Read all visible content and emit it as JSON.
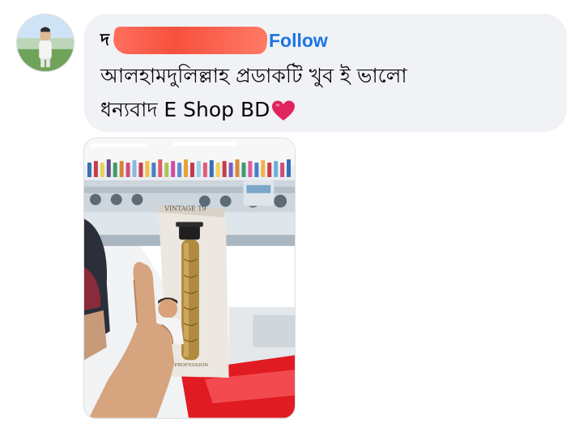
{
  "comment": {
    "author_name": "দ",
    "follow_label": "Follow",
    "text": "আলহামদুলিল্লাহ প্রডাকটি খুব ই ভালো\nধন্যবাদ E Shop BD",
    "reaction_icon": "red-heart-emoji"
  },
  "photo": {
    "box_brand": "VINTAGE T9",
    "box_subtitle": "PROFESSION"
  },
  "colors": {
    "follow": "#1b74e4",
    "bubble": "#f0f2f5",
    "heart": "#e0245e"
  }
}
